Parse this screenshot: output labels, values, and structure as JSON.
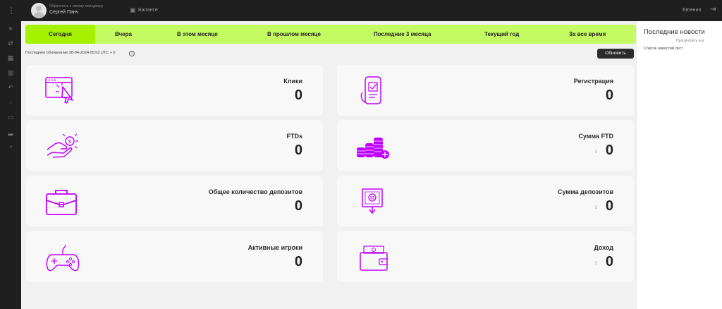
{
  "header": {
    "manager_caption": "Обратитесь к своему менеджеру",
    "manager_name": "Сергей Панч",
    "balance_label": "Балансе",
    "user_name": "Евгения",
    "icons": [
      "menu-dots-icon",
      "user-avatar-icon",
      "wallet-icon",
      "logout-icon"
    ]
  },
  "sidebar": {
    "icons": [
      "database-icon",
      "shuffle-icon",
      "table-icon",
      "bar-chart-icon",
      "undo-icon",
      "bell-icon",
      "gift-icon",
      "podium-icon",
      "user-icon"
    ]
  },
  "tabs": [
    "Сегодня",
    "Вчера",
    "В этом месяце",
    "В прошлом месяце",
    "Последние 3 месяца",
    "Текущий год",
    "За все время"
  ],
  "status": {
    "last_update": "Последнее обновление 28-04-2024 05:53 UTC + 0",
    "refresh_label": "Обновить"
  },
  "cards": [
    {
      "title": "Клики",
      "value": "0",
      "currency": "",
      "icon": "click-window-icon"
    },
    {
      "title": "Регистрация",
      "value": "0",
      "currency": "",
      "icon": "phone-form-icon"
    },
    {
      "title": "FTDs",
      "value": "0",
      "currency": "",
      "icon": "hand-coin-icon"
    },
    {
      "title": "Сумма FTD",
      "value": "0",
      "currency": "$",
      "icon": "coin-stacks-icon"
    },
    {
      "title": "Общее количество депозитов",
      "value": "0",
      "currency": "",
      "icon": "briefcase-icon"
    },
    {
      "title": "Сумма депозитов",
      "value": "0",
      "currency": "$",
      "icon": "deposit-download-icon"
    },
    {
      "title": "Активные игроки",
      "value": "0",
      "currency": "",
      "icon": "gamepad-icon"
    },
    {
      "title": "Доход",
      "value": "0",
      "currency": "$",
      "icon": "wallet-cash-icon"
    }
  ],
  "news": {
    "title": "Последние новости",
    "view_all": "Просмотреть все",
    "empty": "Список новостей пуст"
  },
  "colors": {
    "topbar": "#1f1f1f",
    "tab_bar": "#c5fb62",
    "tab_active": "#a6f100",
    "icon_accent": "#c000ff",
    "card_bg": "#f8f8f8",
    "main_bg": "#f1f1f1"
  }
}
